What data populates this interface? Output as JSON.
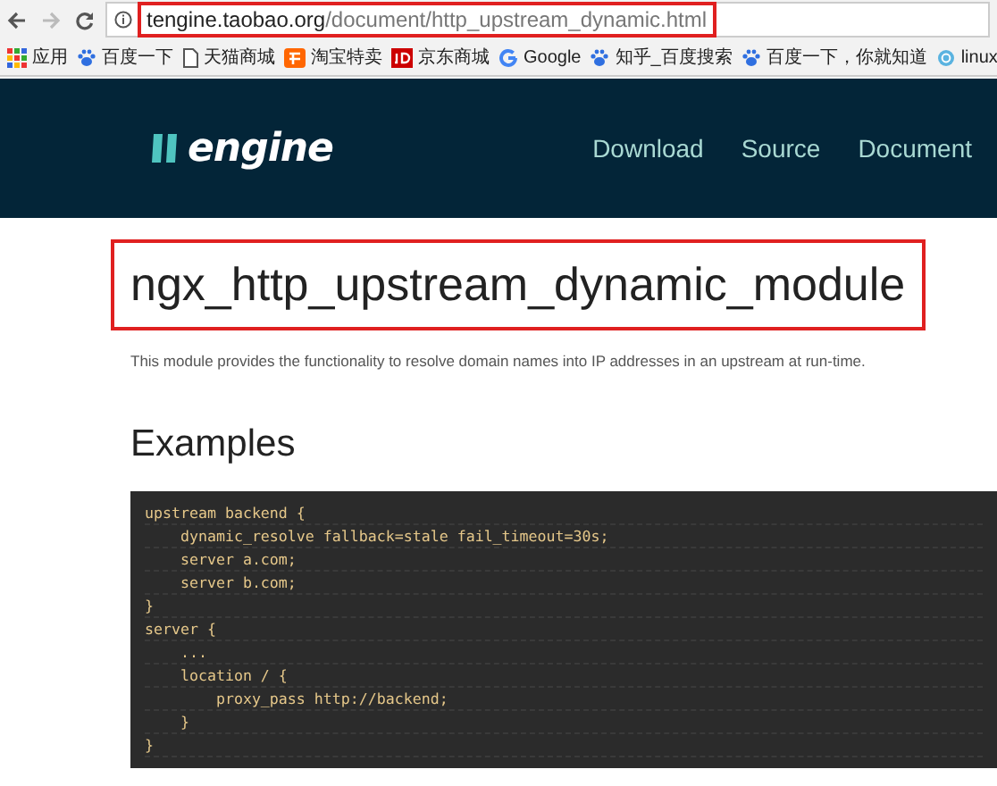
{
  "browser": {
    "url": {
      "host": "tengine.taobao.org",
      "path": "/document/http_upstream_dynamic.html",
      "highlighted": true
    },
    "bookmarks": [
      {
        "kind": "apps",
        "label": "应用"
      },
      {
        "kind": "paw",
        "label": "百度一下"
      },
      {
        "kind": "page",
        "label": "天猫商城"
      },
      {
        "kind": "taobao",
        "label": "淘宝特卖"
      },
      {
        "kind": "jd",
        "label": "京东商城"
      },
      {
        "kind": "google",
        "label": "Google"
      },
      {
        "kind": "paw",
        "label": "知乎_百度搜索"
      },
      {
        "kind": "paw",
        "label": "百度一下，你就知道"
      },
      {
        "kind": "globe",
        "label": "linux"
      }
    ]
  },
  "header": {
    "logo": "engine",
    "nav": [
      "Download",
      "Source",
      "Document"
    ]
  },
  "content": {
    "title": "ngx_http_upstream_dynamic_module",
    "title_highlighted": true,
    "description": "This module provides the functionality to resolve domain names into IP addresses in an upstream at run-time.",
    "section": "Examples",
    "code": [
      "upstream backend {",
      "    dynamic_resolve fallback=stale fail_timeout=30s;",
      "    server a.com;",
      "    server b.com;",
      "}",
      "server {",
      "    ...",
      "    location / {",
      "        proxy_pass http://backend;",
      "    }",
      "}"
    ]
  }
}
